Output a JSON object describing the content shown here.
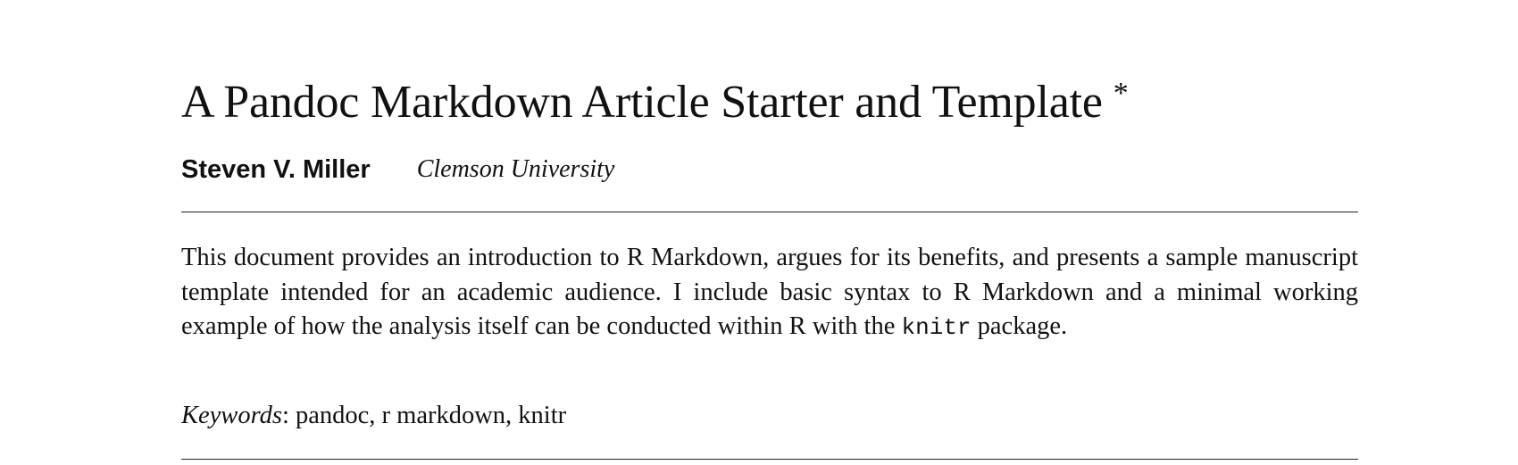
{
  "title": {
    "text": "A Pandoc Markdown Article Starter and Template",
    "thanks_mark": "*"
  },
  "author": {
    "name": "Steven V. Miller",
    "affiliation": "Clemson University"
  },
  "abstract": {
    "before_code": "This document provides an introduction to R Markdown, argues for its benefits, and presents a sample manuscript template intended for an academic audience. I include basic syntax to R Markdown and a minimal working example of how the analysis itself can be conducted within R with the ",
    "code": "knitr",
    "after_code": " package."
  },
  "keywords": {
    "label": "Keywords",
    "separator": ":",
    "values": "pandoc, r markdown, knitr"
  }
}
